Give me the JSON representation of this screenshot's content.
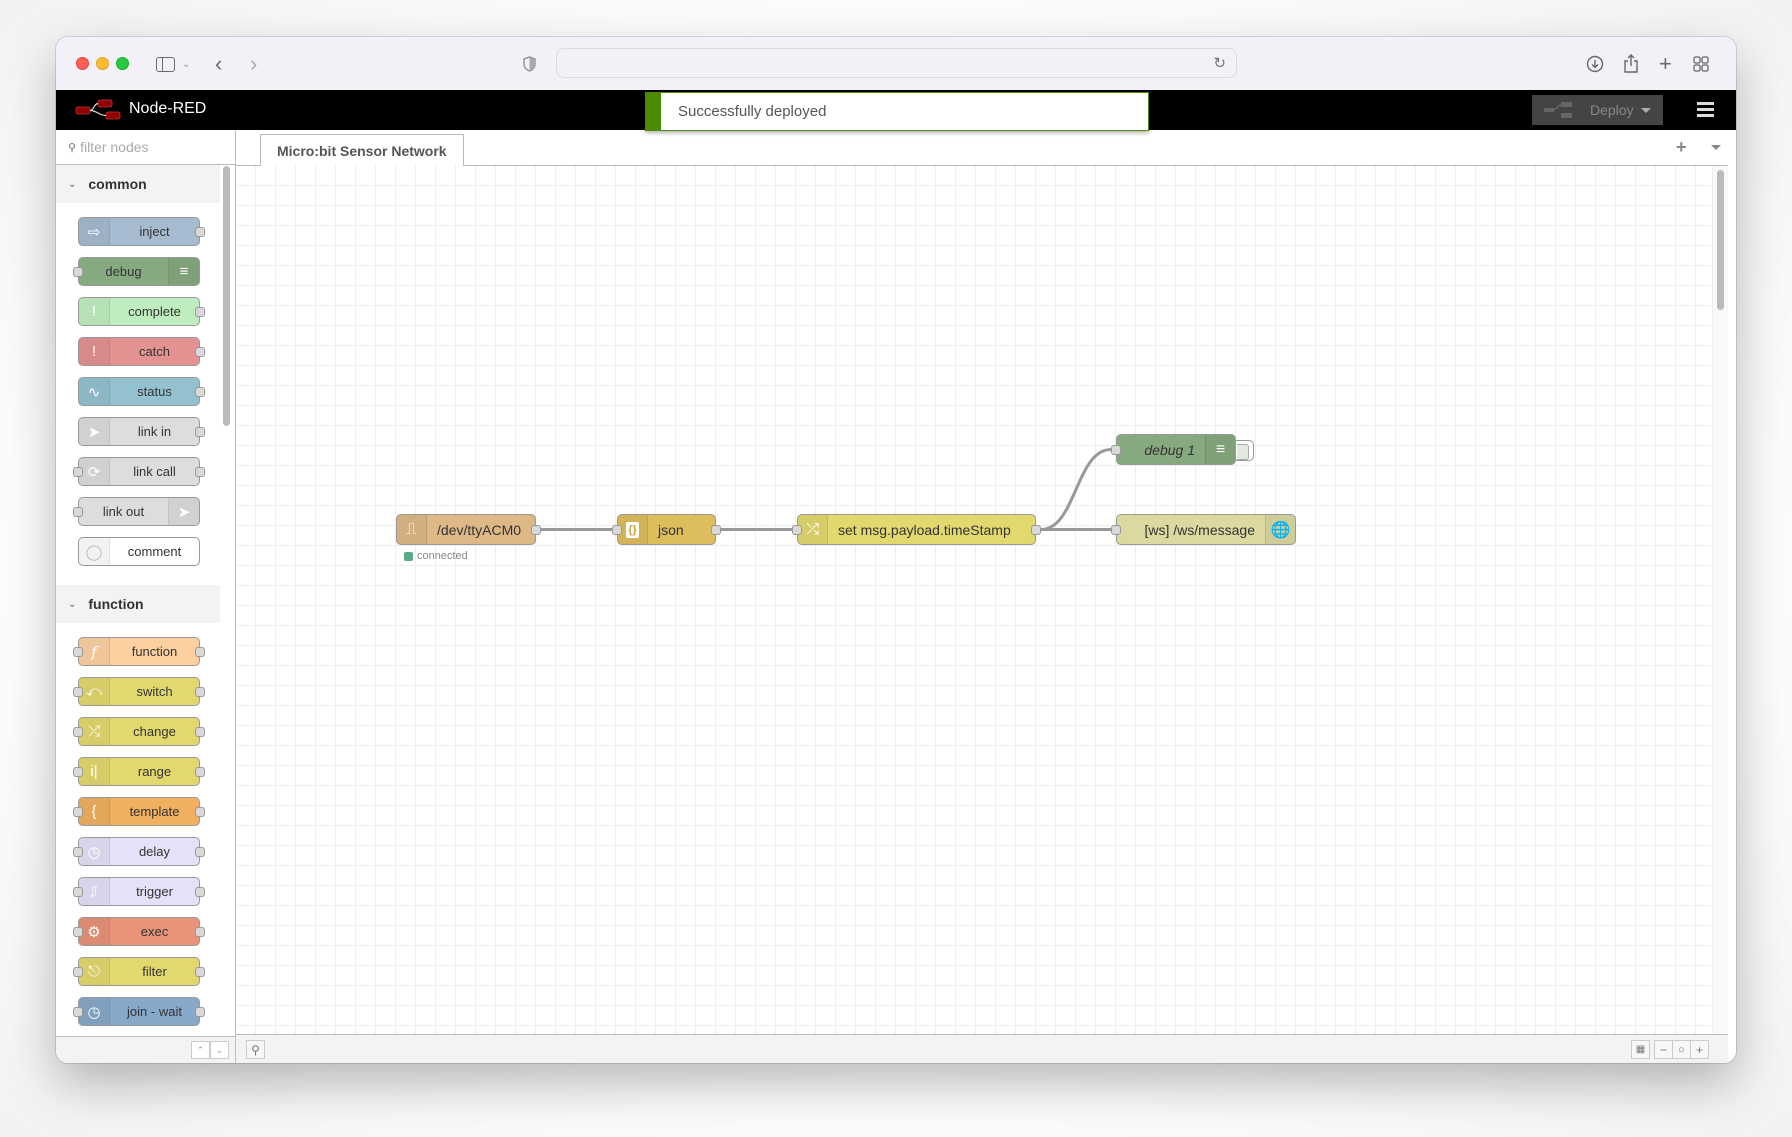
{
  "browser": {
    "url": "",
    "icons": [
      "sidebar-icon",
      "chevron-down-icon",
      "back-icon",
      "forward-icon",
      "shield-icon",
      "reload-icon",
      "download-icon",
      "share-icon",
      "new-tab-icon",
      "tab-overview-icon"
    ]
  },
  "header": {
    "app_name": "Node-RED",
    "deploy_label": "Deploy",
    "notification": "Successfully deployed",
    "colors": {
      "header_bg": "#000000",
      "notify_accent": "#4c8a00"
    }
  },
  "palette": {
    "filter_placeholder": "filter nodes",
    "categories": [
      {
        "name": "common",
        "nodes": [
          {
            "label": "inject",
            "color": "#a6bbcf",
            "icon": "arrow-in",
            "icon_side": "left",
            "in": false,
            "out": true
          },
          {
            "label": "debug",
            "color": "#87a980",
            "icon": "list",
            "icon_side": "right",
            "in": true,
            "out": false
          },
          {
            "label": "complete",
            "color": "#c0edc0",
            "icon": "exclamation",
            "icon_side": "left",
            "in": false,
            "out": true
          },
          {
            "label": "catch",
            "color": "#e49191",
            "icon": "exclamation",
            "icon_side": "left",
            "in": false,
            "out": true
          },
          {
            "label": "status",
            "color": "#94c1d0",
            "icon": "pulse",
            "icon_side": "left",
            "in": false,
            "out": true
          },
          {
            "label": "link in",
            "color": "#dddddd",
            "icon": "link-in",
            "icon_side": "left",
            "in": false,
            "out": true
          },
          {
            "label": "link call",
            "color": "#dddddd",
            "icon": "link-call",
            "icon_side": "left",
            "in": true,
            "out": true
          },
          {
            "label": "link out",
            "color": "#dddddd",
            "icon": "link-out",
            "icon_side": "right",
            "in": true,
            "out": false
          },
          {
            "label": "comment",
            "color": "#ffffff",
            "icon": "speech",
            "icon_side": "left",
            "in": false,
            "out": false
          }
        ]
      },
      {
        "name": "function",
        "nodes": [
          {
            "label": "function",
            "color": "#fdd0a2",
            "icon": "f",
            "icon_side": "left",
            "in": true,
            "out": true
          },
          {
            "label": "switch",
            "color": "#e2d96e",
            "icon": "switch",
            "icon_side": "left",
            "in": true,
            "out": true
          },
          {
            "label": "change",
            "color": "#e2d96e",
            "icon": "shuffle",
            "icon_side": "left",
            "in": true,
            "out": true
          },
          {
            "label": "range",
            "color": "#e2d96e",
            "icon": "range",
            "icon_side": "left",
            "in": true,
            "out": true
          },
          {
            "label": "template",
            "color": "#f0b060",
            "icon": "brace",
            "icon_side": "left",
            "in": true,
            "out": true
          },
          {
            "label": "delay",
            "color": "#e6e0f8",
            "icon": "timer",
            "icon_side": "left",
            "in": true,
            "out": true
          },
          {
            "label": "trigger",
            "color": "#e6e0f8",
            "icon": "trigger",
            "icon_side": "left",
            "in": true,
            "out": true
          },
          {
            "label": "exec",
            "color": "#e8937a",
            "icon": "gear",
            "icon_side": "left",
            "in": true,
            "out": true
          },
          {
            "label": "filter",
            "color": "#e2d96e",
            "icon": "filter",
            "icon_side": "left",
            "in": true,
            "out": true
          },
          {
            "label": "join - wait",
            "color": "#87a9c9",
            "icon": "history",
            "icon_side": "left",
            "in": true,
            "out": true
          }
        ]
      }
    ]
  },
  "workspace": {
    "tab_label": "Micro:bit Sensor Network",
    "flow_nodes": [
      {
        "id": "serial",
        "label": "/dev/ttyACM0",
        "color": "#deb887",
        "icon": "serial",
        "status": "connected",
        "status_color": "#55aa88"
      },
      {
        "id": "json",
        "label": "json",
        "color": "#debd5c",
        "icon": "json"
      },
      {
        "id": "change",
        "label": "set msg.payload.timeStamp",
        "color": "#e2d96e",
        "icon": "shuffle"
      },
      {
        "id": "debug",
        "label": "debug 1",
        "color": "#87a980",
        "icon": "list"
      },
      {
        "id": "ws",
        "label": "[ws] /ws/message",
        "color": "#dbd9a0",
        "icon": "globe"
      }
    ],
    "wires": [
      [
        "serial",
        "json"
      ],
      [
        "json",
        "change"
      ],
      [
        "change",
        "debug"
      ],
      [
        "change",
        "ws"
      ]
    ]
  }
}
